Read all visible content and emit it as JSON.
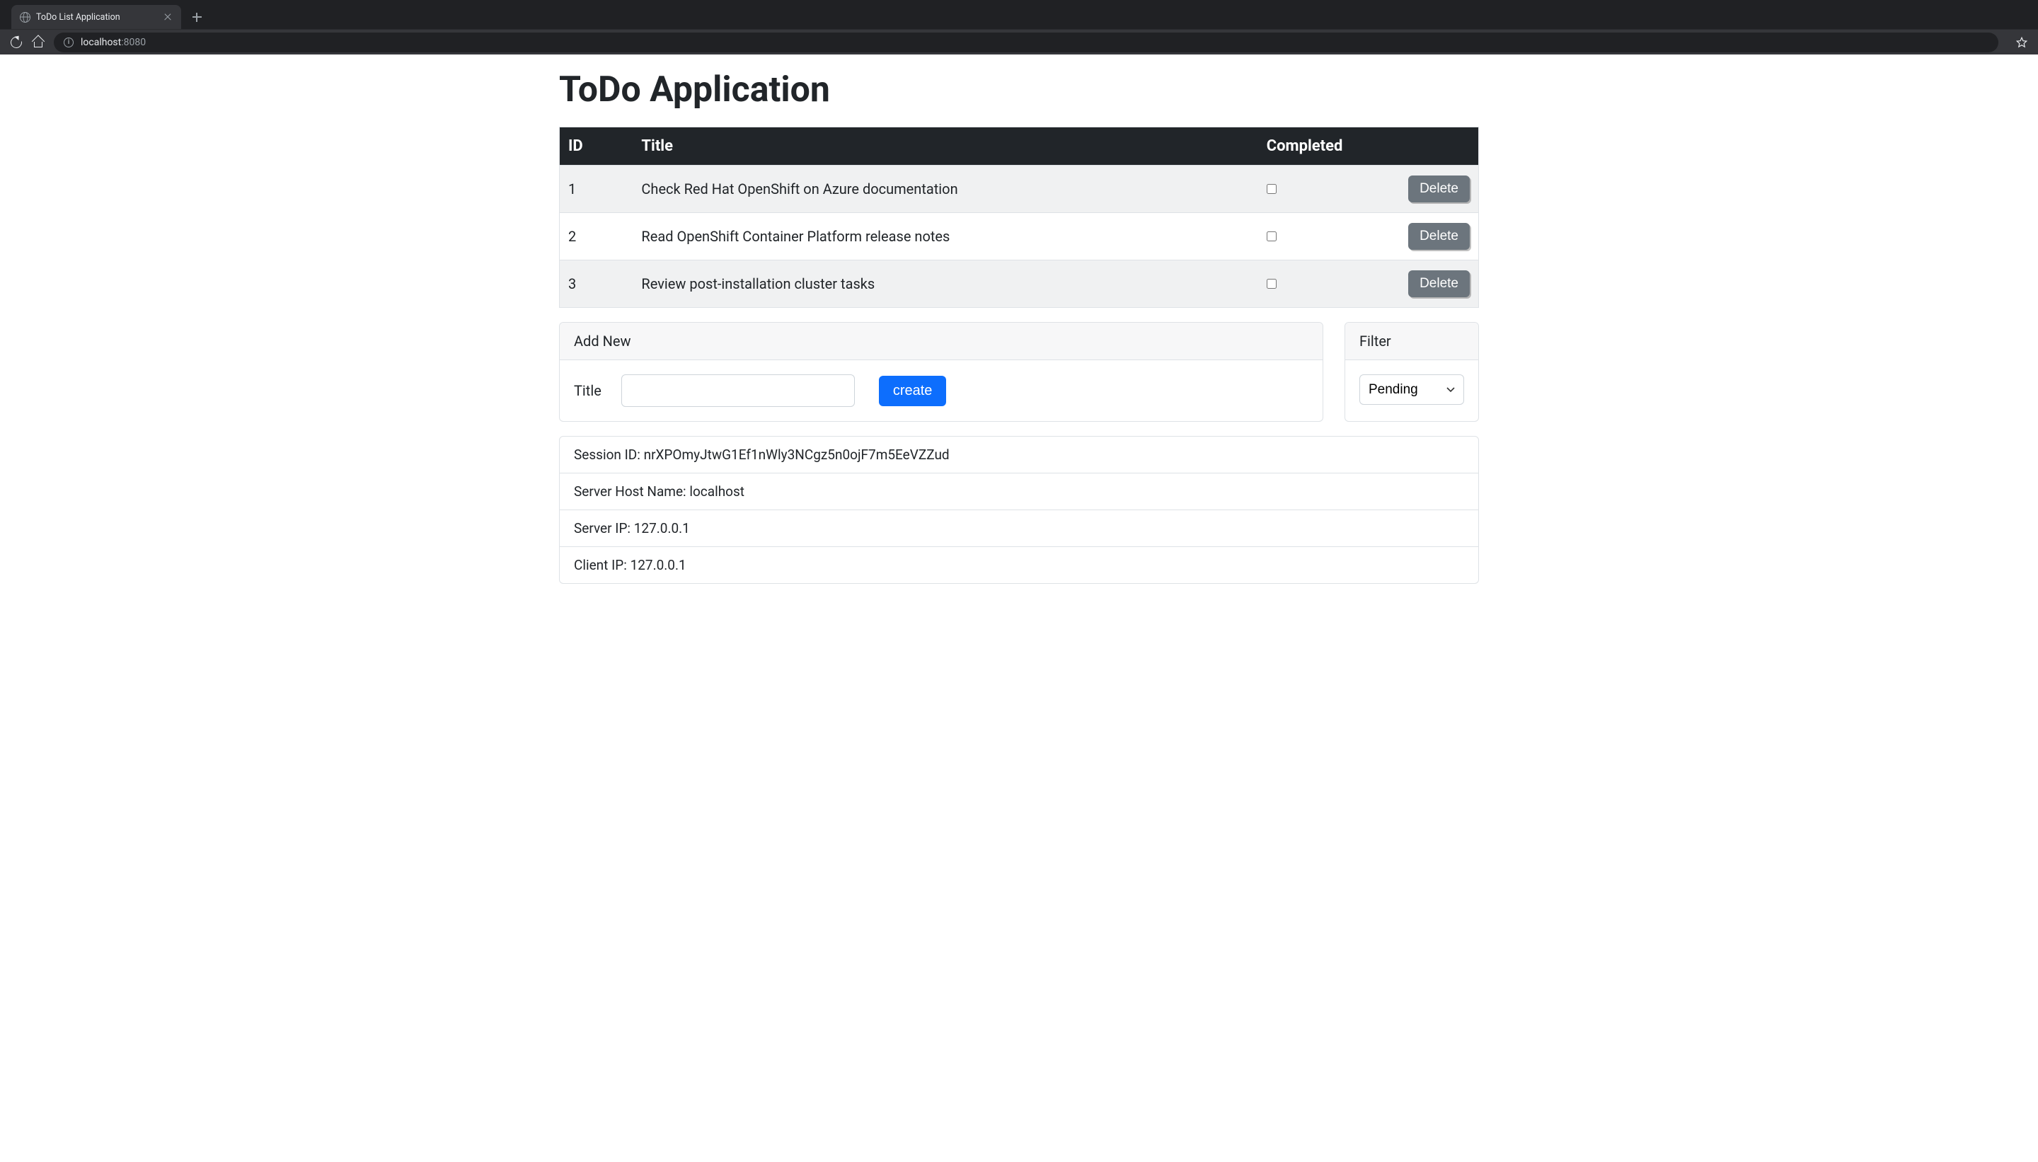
{
  "browser": {
    "tab_title": "ToDo List Application",
    "address_host": "localhost",
    "address_port": ":8080"
  },
  "page": {
    "title": "ToDo Application"
  },
  "table": {
    "headers": {
      "id": "ID",
      "title": "Title",
      "completed": "Completed"
    },
    "rows": [
      {
        "id": "1",
        "title": "Check Red Hat OpenShift on Azure documentation",
        "completed": false,
        "delete": "Delete"
      },
      {
        "id": "2",
        "title": "Read OpenShift Container Platform release notes",
        "completed": false,
        "delete": "Delete"
      },
      {
        "id": "3",
        "title": "Review post-installation cluster tasks",
        "completed": false,
        "delete": "Delete"
      }
    ]
  },
  "add": {
    "header": "Add New",
    "label": "Title",
    "value": "",
    "button": "create"
  },
  "filter": {
    "header": "Filter",
    "selected": "Pending"
  },
  "info": {
    "session": "Session ID: nrXPOmyJtwG1Ef1nWly3NCgz5n0ojF7m5EeVZZud",
    "host": "Server Host Name: localhost",
    "server_ip": "Server IP: 127.0.0.1",
    "client_ip": "Client IP: 127.0.0.1"
  }
}
